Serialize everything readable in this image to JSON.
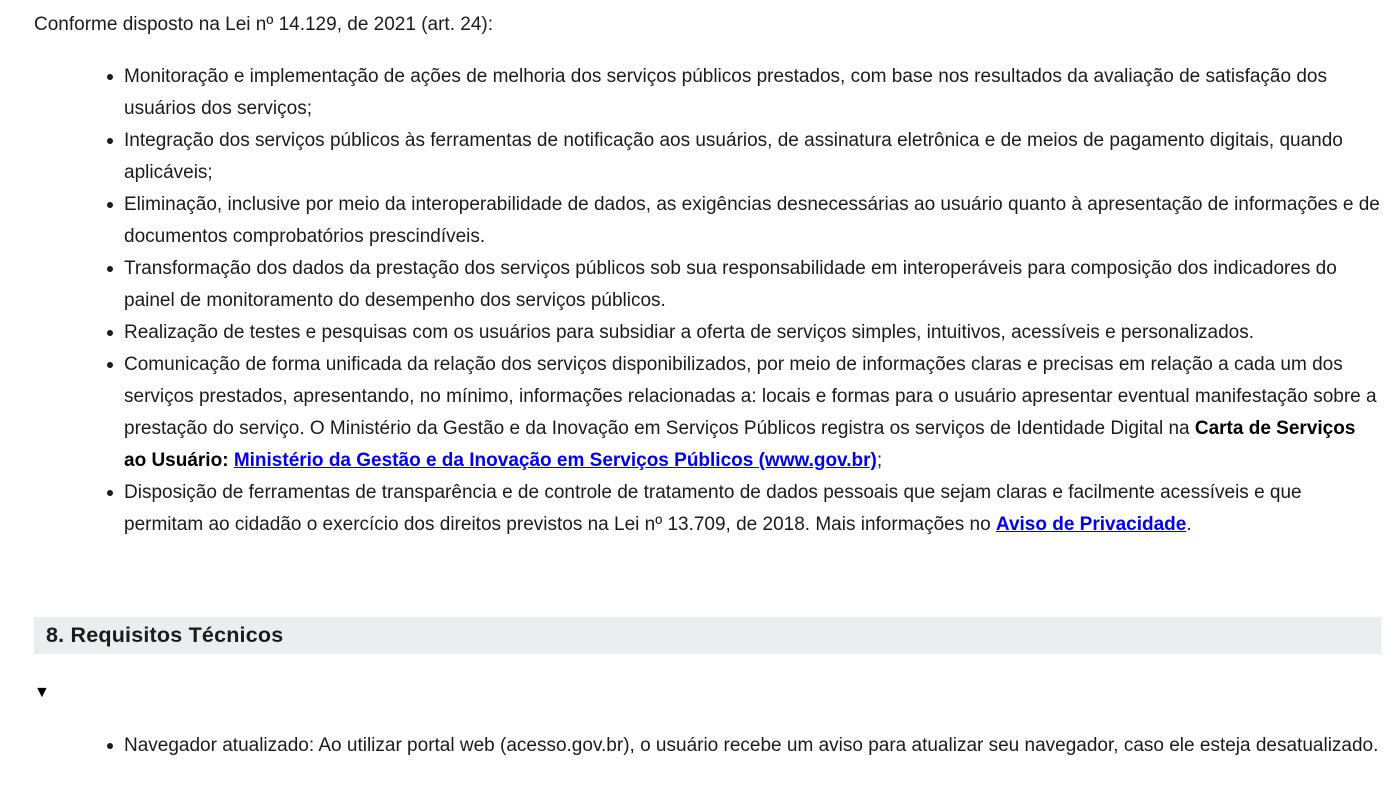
{
  "intro": "Conforme disposto na Lei nº 14.129, de 2021 (art. 24):",
  "items": [
    "Monitoração e implementação de ações de melhoria dos serviços públicos prestados, com base nos resultados da avaliação de satisfação dos usuários dos serviços;",
    "Integração dos serviços públicos às ferramentas de notificação aos usuários, de assinatura eletrônica e de meios de pagamento digitais, quando aplicáveis;",
    "Eliminação, inclusive por meio da interoperabilidade de dados, as exigências desnecessárias ao usuário quanto à apresentação de informações e de documentos comprobatórios prescindíveis.",
    "Transformação dos dados da prestação dos serviços públicos sob sua responsabilidade em interoperáveis para composição dos indicadores do painel de monitoramento do desempenho dos serviços públicos.",
    "Realização de testes e pesquisas com os usuários para subsidiar a oferta de serviços simples, intuitivos, acessíveis e personalizados."
  ],
  "item6": {
    "text": "Comunicação de forma unificada da relação dos serviços disponibilizados, por meio de informações claras e precisas em relação a cada um dos serviços prestados, apresentando, no mínimo, informações relacionadas a: locais e formas para o usuário apresentar eventual manifestação sobre a prestação do serviço. O Ministério da Gestão e da Inovação em Serviços Públicos registra os serviços de Identidade Digital na ",
    "bold": "Carta de Serviços ao Usuário:",
    "link": "Ministério da Gestão e da Inovação em Serviços Públicos (www.gov.br)",
    "end": ";"
  },
  "item7": {
    "text": "Disposição de ferramentas de transparência e de controle de tratamento de dados pessoais que sejam claras e facilmente acessíveis e que permitam ao cidadão o exercício dos direitos previstos na Lei nº 13.709, de 2018. Mais informações no ",
    "link": "Aviso de Privacidade",
    "end": "."
  },
  "section": {
    "title": "8. Requisitos Técnicos",
    "toggle_glyph": "▼",
    "items": [
      "Navegador atualizado: Ao utilizar portal web (acesso.gov.br), o usuário recebe um aviso para atualizar seu navegador, caso ele esteja desatualizado."
    ]
  }
}
